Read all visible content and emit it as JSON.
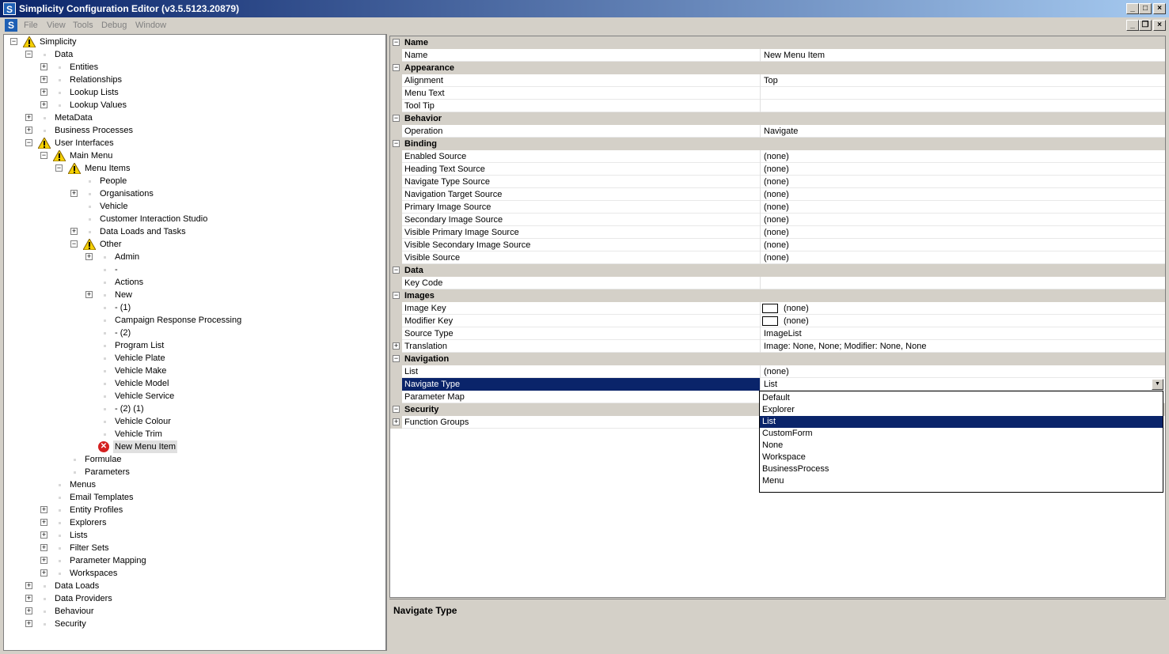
{
  "window": {
    "title": "Simplicity Configuration Editor (v3.5.5123.20879)",
    "app_icon_letter": "S"
  },
  "menubar": {
    "items": [
      "File",
      "View",
      "Tools",
      "Debug",
      "Window"
    ]
  },
  "tree": {
    "items": [
      {
        "label": "Simplicity",
        "level": 0,
        "exp": "minus",
        "icon": "warning"
      },
      {
        "label": "Data",
        "level": 1,
        "exp": "minus",
        "icon": "dot"
      },
      {
        "label": "Entities",
        "level": 2,
        "exp": "plus",
        "icon": "dot"
      },
      {
        "label": "Relationships",
        "level": 2,
        "exp": "plus",
        "icon": "dot"
      },
      {
        "label": "Lookup Lists",
        "level": 2,
        "exp": "plus",
        "icon": "dot"
      },
      {
        "label": "Lookup Values",
        "level": 2,
        "exp": "plus",
        "icon": "dot"
      },
      {
        "label": "MetaData",
        "level": 1,
        "exp": "plus",
        "icon": "dot"
      },
      {
        "label": "Business Processes",
        "level": 1,
        "exp": "plus",
        "icon": "dot"
      },
      {
        "label": "User Interfaces",
        "level": 1,
        "exp": "minus",
        "icon": "warning"
      },
      {
        "label": "Main Menu",
        "level": 2,
        "exp": "minus",
        "icon": "warning"
      },
      {
        "label": "Menu Items",
        "level": 3,
        "exp": "minus",
        "icon": "warning"
      },
      {
        "label": "People",
        "level": 4,
        "exp": "none",
        "icon": "dot"
      },
      {
        "label": "Organisations",
        "level": 4,
        "exp": "plus",
        "icon": "dot"
      },
      {
        "label": "Vehicle",
        "level": 4,
        "exp": "none",
        "icon": "dot"
      },
      {
        "label": "Customer Interaction Studio",
        "level": 4,
        "exp": "none",
        "icon": "dot"
      },
      {
        "label": "Data Loads and Tasks",
        "level": 4,
        "exp": "plus",
        "icon": "dot"
      },
      {
        "label": "Other",
        "level": 4,
        "exp": "minus",
        "icon": "warning"
      },
      {
        "label": "Admin",
        "level": 5,
        "exp": "plus",
        "icon": "dot"
      },
      {
        "label": "-",
        "level": 5,
        "exp": "none",
        "icon": "dot"
      },
      {
        "label": "Actions",
        "level": 5,
        "exp": "none",
        "icon": "dot"
      },
      {
        "label": "New",
        "level": 5,
        "exp": "plus",
        "icon": "dot"
      },
      {
        "label": "- (1)",
        "level": 5,
        "exp": "none",
        "icon": "dot"
      },
      {
        "label": "Campaign Response Processing",
        "level": 5,
        "exp": "none",
        "icon": "dot"
      },
      {
        "label": "- (2)",
        "level": 5,
        "exp": "none",
        "icon": "dot"
      },
      {
        "label": "Program List",
        "level": 5,
        "exp": "none",
        "icon": "dot"
      },
      {
        "label": "Vehicle Plate",
        "level": 5,
        "exp": "none",
        "icon": "dot"
      },
      {
        "label": "Vehicle Make",
        "level": 5,
        "exp": "none",
        "icon": "dot"
      },
      {
        "label": "Vehicle Model",
        "level": 5,
        "exp": "none",
        "icon": "dot"
      },
      {
        "label": "Vehicle Service",
        "level": 5,
        "exp": "none",
        "icon": "dot"
      },
      {
        "label": "- (2) (1)",
        "level": 5,
        "exp": "none",
        "icon": "dot"
      },
      {
        "label": "Vehicle Colour",
        "level": 5,
        "exp": "none",
        "icon": "dot"
      },
      {
        "label": "Vehicle Trim",
        "level": 5,
        "exp": "none",
        "icon": "dot"
      },
      {
        "label": "New Menu Item",
        "level": 5,
        "exp": "none",
        "icon": "error",
        "selected": true
      },
      {
        "label": "Formulae",
        "level": 3,
        "exp": "none",
        "icon": "dot"
      },
      {
        "label": "Parameters",
        "level": 3,
        "exp": "none",
        "icon": "dot"
      },
      {
        "label": "Menus",
        "level": 2,
        "exp": "none",
        "icon": "dot"
      },
      {
        "label": "Email Templates",
        "level": 2,
        "exp": "none",
        "icon": "dot"
      },
      {
        "label": "Entity Profiles",
        "level": 2,
        "exp": "plus",
        "icon": "dot"
      },
      {
        "label": "Explorers",
        "level": 2,
        "exp": "plus",
        "icon": "dot"
      },
      {
        "label": "Lists",
        "level": 2,
        "exp": "plus",
        "icon": "dot"
      },
      {
        "label": "Filter Sets",
        "level": 2,
        "exp": "plus",
        "icon": "dot"
      },
      {
        "label": "Parameter Mapping",
        "level": 2,
        "exp": "plus",
        "icon": "dot"
      },
      {
        "label": "Workspaces",
        "level": 2,
        "exp": "plus",
        "icon": "dot"
      },
      {
        "label": "Data Loads",
        "level": 1,
        "exp": "plus",
        "icon": "dot"
      },
      {
        "label": "Data Providers",
        "level": 1,
        "exp": "plus",
        "icon": "dot"
      },
      {
        "label": "Behaviour",
        "level": 1,
        "exp": "plus",
        "icon": "dot"
      },
      {
        "label": "Security",
        "level": 1,
        "exp": "plus",
        "icon": "dot"
      }
    ]
  },
  "properties": {
    "rows": [
      {
        "type": "category",
        "name": "Name"
      },
      {
        "type": "prop",
        "name": "Name",
        "value": "New Menu Item"
      },
      {
        "type": "category",
        "name": "Appearance"
      },
      {
        "type": "prop",
        "name": "Alignment",
        "value": "Top"
      },
      {
        "type": "prop",
        "name": "Menu Text",
        "value": ""
      },
      {
        "type": "prop",
        "name": "Tool Tip",
        "value": ""
      },
      {
        "type": "category",
        "name": "Behavior"
      },
      {
        "type": "prop",
        "name": "Operation",
        "value": "Navigate"
      },
      {
        "type": "category",
        "name": "Binding"
      },
      {
        "type": "prop",
        "name": "Enabled Source",
        "value": "(none)"
      },
      {
        "type": "prop",
        "name": "Heading Text Source",
        "value": "(none)"
      },
      {
        "type": "prop",
        "name": "Navigate Type Source",
        "value": "(none)"
      },
      {
        "type": "prop",
        "name": "Navigation Target Source",
        "value": "(none)"
      },
      {
        "type": "prop",
        "name": "Primary Image Source",
        "value": "(none)"
      },
      {
        "type": "prop",
        "name": "Secondary Image Source",
        "value": "(none)"
      },
      {
        "type": "prop",
        "name": "Visible Primary Image Source",
        "value": "(none)"
      },
      {
        "type": "prop",
        "name": "Visible Secondary Image Source",
        "value": "(none)"
      },
      {
        "type": "prop",
        "name": "Visible Source",
        "value": "(none)"
      },
      {
        "type": "category",
        "name": "Data"
      },
      {
        "type": "prop",
        "name": "Key Code",
        "value": ""
      },
      {
        "type": "category",
        "name": "Images"
      },
      {
        "type": "prop",
        "name": "Image Key",
        "value": "(none)",
        "imgbox": true
      },
      {
        "type": "prop",
        "name": "Modifier Key",
        "value": "(none)",
        "imgbox": true
      },
      {
        "type": "prop",
        "name": "Source Type",
        "value": "ImageList"
      },
      {
        "type": "prop",
        "name": "Translation",
        "value": "Image: None, None; Modifier: None, None",
        "expandable": true
      },
      {
        "type": "category",
        "name": "Navigation"
      },
      {
        "type": "prop",
        "name": "List",
        "value": "(none)"
      },
      {
        "type": "prop",
        "name": "Navigate Type",
        "value": "List",
        "selected": true,
        "combo": true
      },
      {
        "type": "prop",
        "name": "Parameter Map",
        "value": ""
      },
      {
        "type": "category",
        "name": "Security"
      },
      {
        "type": "prop",
        "name": "Function Groups",
        "value": "",
        "expandable": true
      }
    ]
  },
  "dropdown": {
    "options": [
      "Default",
      "Explorer",
      "List",
      "CustomForm",
      "None",
      "Workspace",
      "BusinessProcess",
      "Menu"
    ],
    "selected": "List"
  },
  "description": {
    "title": "Navigate Type"
  }
}
